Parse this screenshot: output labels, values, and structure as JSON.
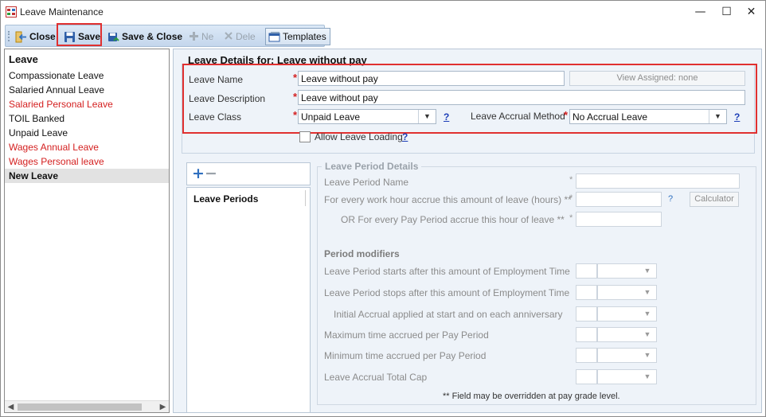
{
  "window": {
    "title": "Leave Maintenance",
    "minimize": "—",
    "maximize": "☐",
    "close": "✕"
  },
  "toolbar": {
    "close_label": "Close",
    "save_label": "Save",
    "save_close_label": "Save & Close",
    "new_label": "Ne",
    "delete_label": "Dele",
    "templates_label": "Templates"
  },
  "left": {
    "header": "Leave",
    "items": [
      {
        "label": "Compassionate Leave",
        "color": "black"
      },
      {
        "label": "Salaried Annual Leave",
        "color": "black"
      },
      {
        "label": "Salaried Personal Leave",
        "color": "red"
      },
      {
        "label": "TOIL Banked",
        "color": "black"
      },
      {
        "label": "Unpaid Leave",
        "color": "black"
      },
      {
        "label": "Wages Annual Leave",
        "color": "red"
      },
      {
        "label": "Wages Personal leave",
        "color": "red"
      },
      {
        "label": "New Leave",
        "color": "black",
        "selected": true
      }
    ]
  },
  "details": {
    "title": "Leave Details for: Leave without pay",
    "leave_name_label": "Leave Name",
    "leave_name_value": "Leave without pay",
    "view_assigned": "View Assigned: none",
    "leave_desc_label": "Leave Description",
    "leave_desc_value": "Leave without pay",
    "leave_class_label": "Leave Class",
    "leave_class_value": "Unpaid Leave",
    "accrual_method_label": "Leave Accrual Method",
    "accrual_method_value": "No Accrual Leave",
    "help_mark": "?",
    "required_mark": "*",
    "allow_loading_label": "Allow Leave Loading"
  },
  "periods": {
    "add_icon": "+",
    "remove_icon": "−",
    "header": "Leave Periods"
  },
  "period_details": {
    "title": "Leave Period Details",
    "name_label": "Leave Period Name",
    "work_hour_label": "For every work hour accrue this amount of leave (hours)  **",
    "pay_period_label": "OR For every Pay Period accrue this hour of leave **",
    "calculator_label": "Calculator",
    "help_mark": "?",
    "required_mark": "*",
    "modifiers_title": "Period modifiers",
    "modifiers": [
      "Leave Period starts after this amount of Employment Time",
      "Leave Period stops after this amount of Employment Time",
      "Initial Accrual applied at start and on each anniversary",
      "Maximum time accrued per Pay Period",
      "Minimum time accrued per Pay Period",
      "Leave Accrual Total Cap"
    ],
    "footnote": "** Field may be overridden at pay grade level."
  },
  "colors": {
    "required": "#d42020",
    "help": "#1d3fb8",
    "highlight": "#e03030",
    "pane_bg": "#eef3f9"
  }
}
